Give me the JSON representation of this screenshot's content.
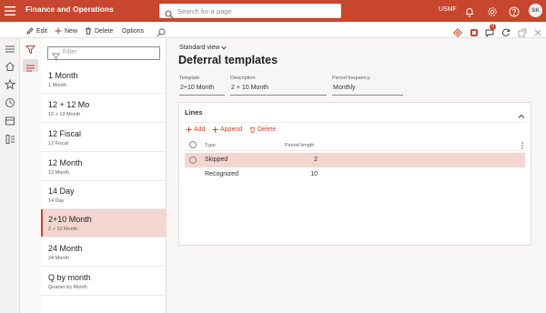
{
  "app": {
    "title": "Finance and Operations",
    "search_placeholder": "Search for a page",
    "company": "USMF",
    "user_initials": "SK",
    "accent": "#c8462d"
  },
  "actions": {
    "edit": "Edit",
    "new": "New",
    "delete": "Delete",
    "options": "Options",
    "notification_count": "0"
  },
  "list": {
    "filter_placeholder": "Filter",
    "items": [
      {
        "title": "1 Month",
        "subtitle": "1 Month"
      },
      {
        "title": "12 + 12 Mo",
        "subtitle": "12 + 12 Month"
      },
      {
        "title": "12 Fiscal",
        "subtitle": "12 Fiscal"
      },
      {
        "title": "12 Month",
        "subtitle": "12 Month"
      },
      {
        "title": "14 Day",
        "subtitle": "14 Day"
      },
      {
        "title": "2+10 Month",
        "subtitle": "2 + 10 Month"
      },
      {
        "title": "24 Month",
        "subtitle": "24 Month"
      },
      {
        "title": "Q by month",
        "subtitle": "Quarter by Month"
      }
    ],
    "selected_index": 5
  },
  "main": {
    "view_label": "Standard view",
    "page_title": "Deferral templates",
    "fields": {
      "template": {
        "label": "Template",
        "value": "2+10 Month"
      },
      "description": {
        "label": "Description",
        "value": "2 + 10 Month"
      },
      "period_frequency": {
        "label": "Period frequency",
        "value": "Monthly"
      }
    },
    "lines": {
      "header": "Lines",
      "add": "Add",
      "append": "Append",
      "delete": "Delete",
      "columns": {
        "type": "Type",
        "period_length": "Period length"
      },
      "rows": [
        {
          "type": "Skipped",
          "period_length": "2"
        },
        {
          "type": "Recognized",
          "period_length": "10"
        }
      ]
    }
  }
}
